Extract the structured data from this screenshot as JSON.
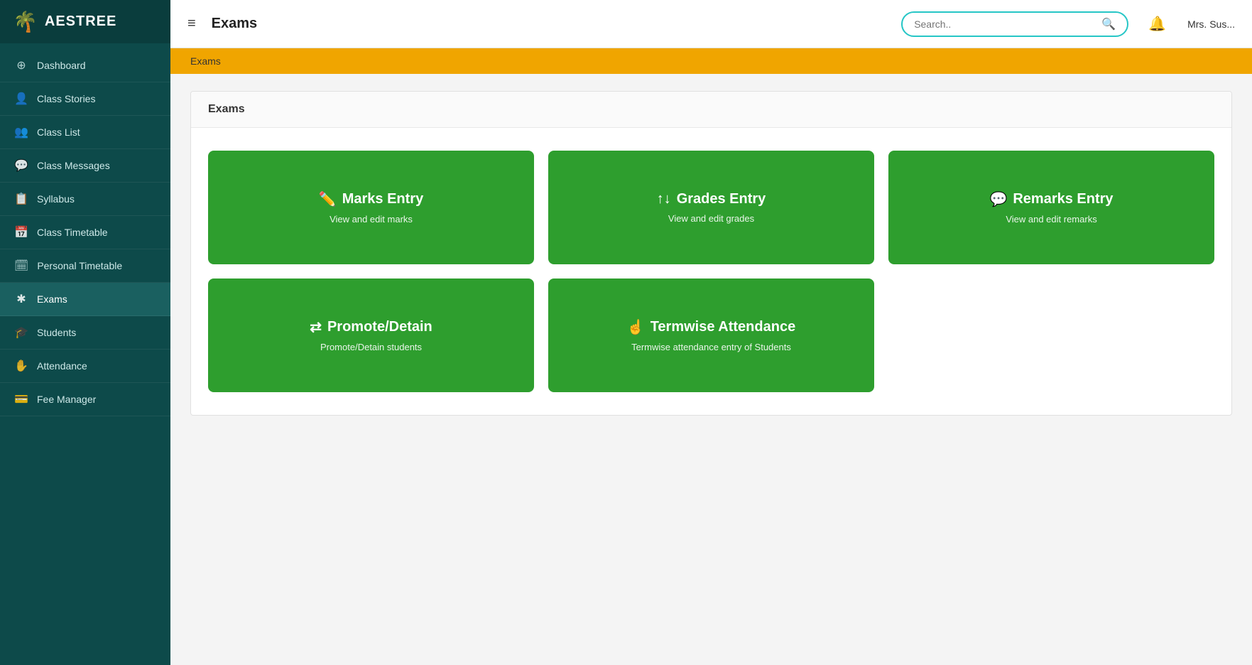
{
  "app": {
    "logo_icon": "🌴",
    "logo_text": "AESTREE"
  },
  "sidebar": {
    "items": [
      {
        "id": "dashboard",
        "label": "Dashboard",
        "icon": "⊕",
        "active": false
      },
      {
        "id": "class-stories",
        "label": "Class Stories",
        "icon": "👤",
        "active": false
      },
      {
        "id": "class-list",
        "label": "Class List",
        "icon": "👥",
        "active": false
      },
      {
        "id": "class-messages",
        "label": "Class Messages",
        "icon": "💬",
        "active": false
      },
      {
        "id": "syllabus",
        "label": "Syllabus",
        "icon": "📋",
        "active": false
      },
      {
        "id": "class-timetable",
        "label": "Class Timetable",
        "icon": "📅",
        "active": false
      },
      {
        "id": "personal-timetable",
        "label": "Personal Timetable",
        "icon": "🗓",
        "active": false
      },
      {
        "id": "exams",
        "label": "Exams",
        "icon": "✱",
        "active": true
      },
      {
        "id": "students",
        "label": "Students",
        "icon": "🎓",
        "active": false
      },
      {
        "id": "attendance",
        "label": "Attendance",
        "icon": "✋",
        "active": false
      },
      {
        "id": "fee-manager",
        "label": "Fee Manager",
        "icon": "💳",
        "active": false
      }
    ]
  },
  "header": {
    "hamburger": "≡",
    "title": "Exams",
    "search_placeholder": "Search..",
    "bell_icon": "🔔",
    "user_name": "Mrs. Sus..."
  },
  "breadcrumb": {
    "text": "Exams"
  },
  "main_card": {
    "title": "Exams"
  },
  "tiles": [
    {
      "id": "marks-entry",
      "icon": "✏️",
      "title": "Marks Entry",
      "subtitle": "View and edit marks"
    },
    {
      "id": "grades-entry",
      "icon": "↑↓",
      "title": "Grades Entry",
      "subtitle": "View and edit grades"
    },
    {
      "id": "remarks-entry",
      "icon": "💬",
      "title": "Remarks Entry",
      "subtitle": "View and edit remarks"
    }
  ],
  "tiles_bottom": [
    {
      "id": "promote-detain",
      "icon": "⇄",
      "title": "Promote/Detain",
      "subtitle": "Promote/Detain students"
    },
    {
      "id": "termwise-attendance",
      "icon": "☝️",
      "title": "Termwise Attendance",
      "subtitle": "Termwise attendance entry of Students"
    }
  ]
}
